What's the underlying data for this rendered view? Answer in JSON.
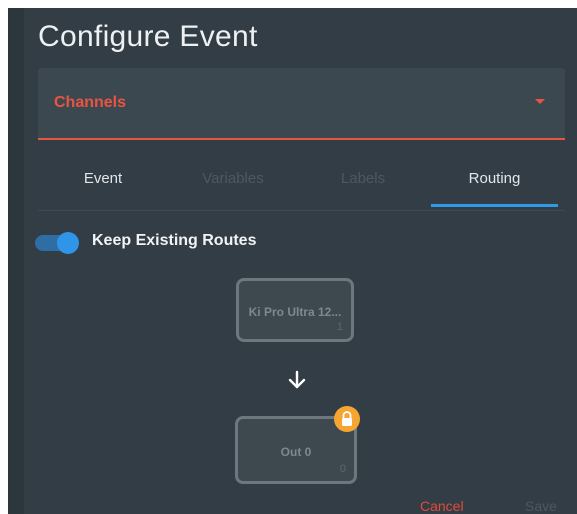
{
  "dialog": {
    "title": "Configure Event"
  },
  "select": {
    "value": "Channels"
  },
  "tabs": [
    {
      "label": "Event",
      "active": false,
      "enabled": true
    },
    {
      "label": "Variables",
      "active": false,
      "enabled": false
    },
    {
      "label": "Labels",
      "active": false,
      "enabled": false
    },
    {
      "label": "Routing",
      "active": true,
      "enabled": true
    }
  ],
  "toggle": {
    "label": "Keep Existing Routes",
    "on": true
  },
  "routing": {
    "source": {
      "name": "Ki Pro Ultra 12...",
      "port": "1"
    },
    "destination": {
      "name": "Out 0",
      "port": "0",
      "locked": true
    }
  },
  "footer": {
    "cancel_label": "Cancel",
    "save_label": "Save"
  },
  "colors": {
    "dialog_bg": "#323d45",
    "accent_red": "#ea5443",
    "accent_blue": "#2f9be6",
    "lock_orange": "#f6a530"
  },
  "icons": {
    "dropdown": "caret-down-icon",
    "arrow": "arrow-down-icon",
    "lock": "lock-icon"
  }
}
